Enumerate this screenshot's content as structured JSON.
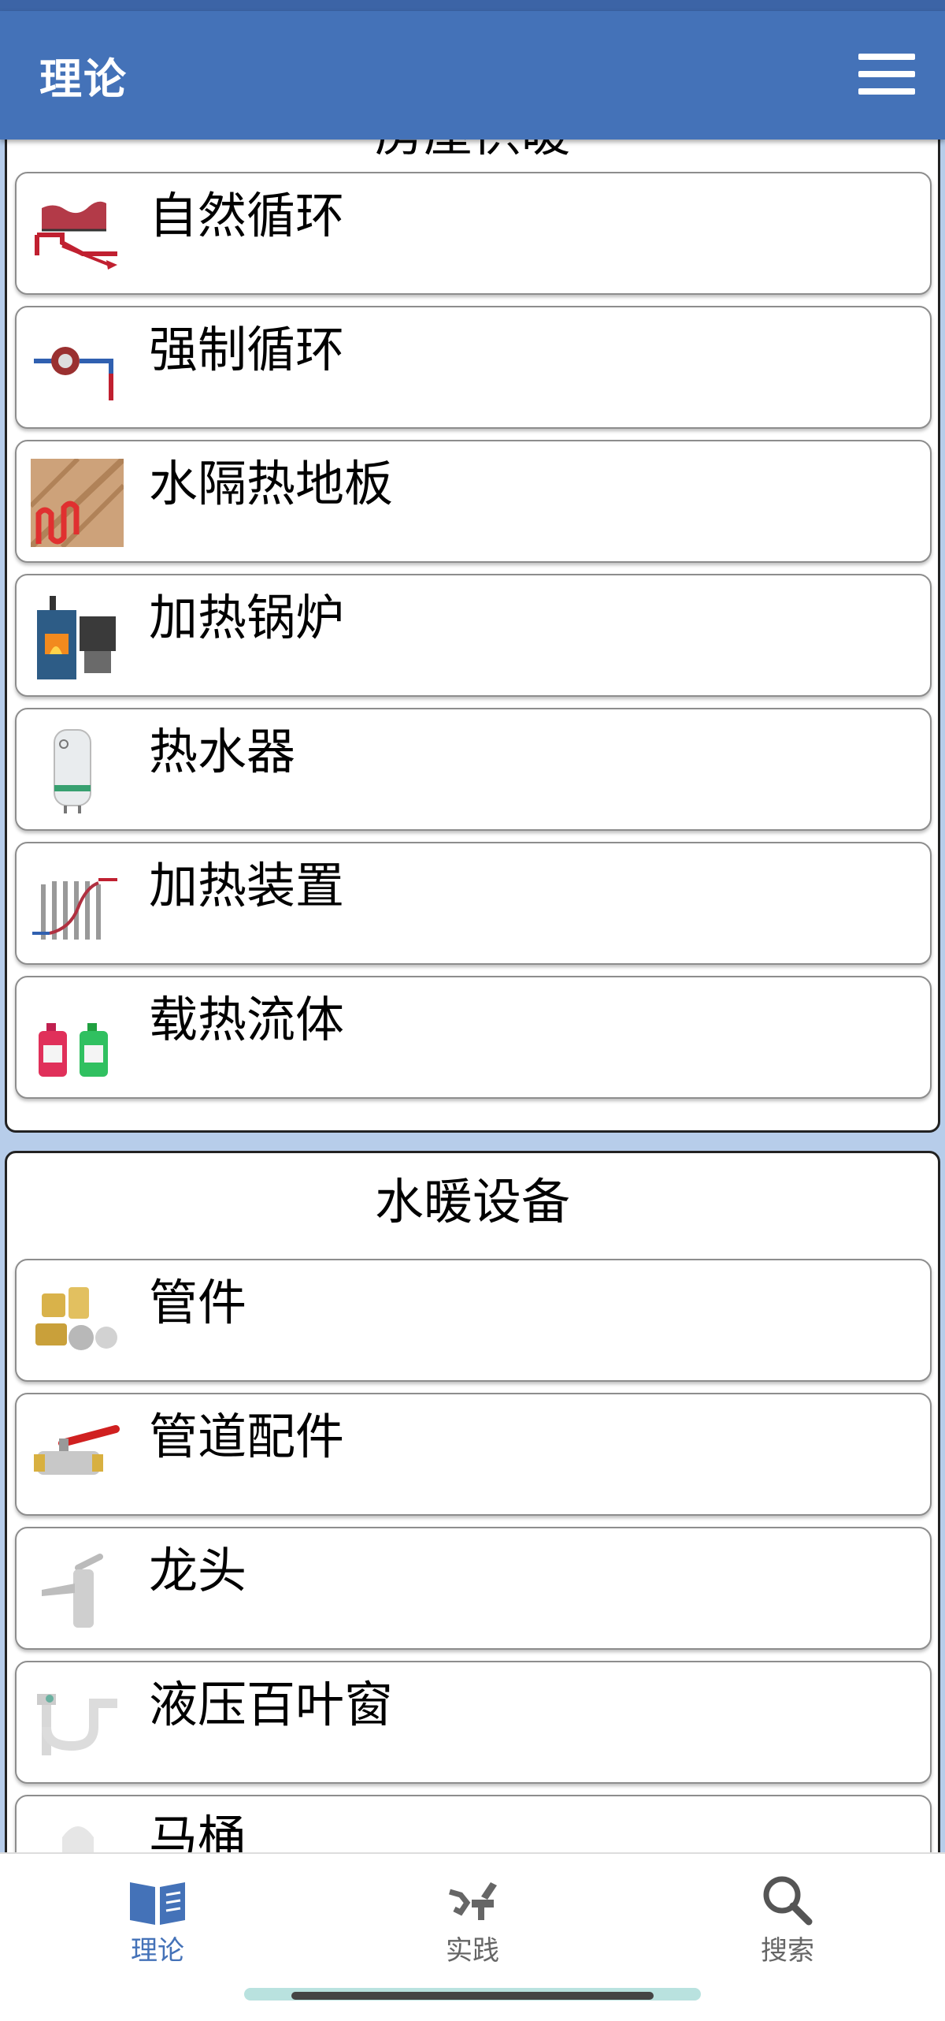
{
  "header": {
    "title": "理论"
  },
  "section1": {
    "title": "房屋供暖",
    "items": [
      {
        "label": "自然循环",
        "icon": "natural-circulation-icon"
      },
      {
        "label": "强制循环",
        "icon": "forced-circulation-pump-icon"
      },
      {
        "label": "水隔热地板",
        "icon": "underfloor-heating-icon"
      },
      {
        "label": "加热锅炉",
        "icon": "boiler-icon"
      },
      {
        "label": "热水器",
        "icon": "water-heater-icon"
      },
      {
        "label": "加热装置",
        "icon": "radiator-icon"
      },
      {
        "label": "载热流体",
        "icon": "coolant-bottles-icon"
      }
    ]
  },
  "section2": {
    "title": "水暖设备",
    "items": [
      {
        "label": "管件",
        "icon": "fittings-icon"
      },
      {
        "label": "管道配件",
        "icon": "ball-valve-icon"
      },
      {
        "label": "龙头",
        "icon": "faucet-icon"
      },
      {
        "label": "液压百叶窗",
        "icon": "siphon-icon"
      },
      {
        "label": "马桶",
        "icon": "toilet-icon"
      }
    ]
  },
  "bottom_nav": [
    {
      "label": "理论",
      "icon": "book-icon",
      "active": true
    },
    {
      "label": "实践",
      "icon": "plumbing-tools-icon",
      "active": false
    },
    {
      "label": "搜索",
      "icon": "search-icon",
      "active": false
    }
  ],
  "colors": {
    "primary": "#4472b8",
    "background": "#b7cdea"
  }
}
